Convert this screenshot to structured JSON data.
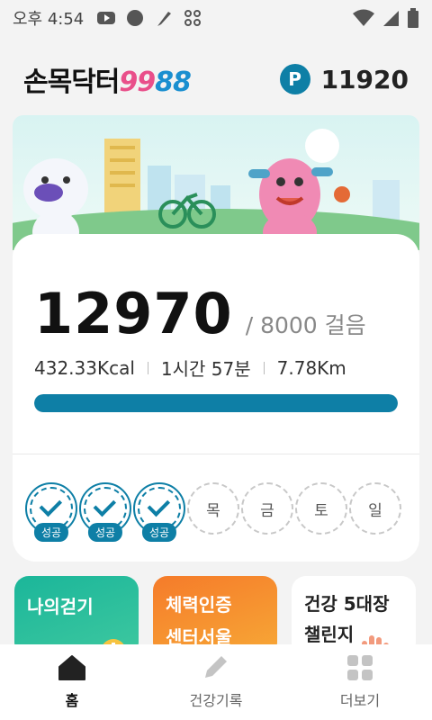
{
  "status": {
    "time": "오후 4:54"
  },
  "header": {
    "logo_text": "손목닥터",
    "logo_num1": "99",
    "logo_num2": "88",
    "point_badge": "P",
    "points": "11920"
  },
  "steps": {
    "current": "12970",
    "goal": "/ 8000 걸음",
    "progress_fraction": 1.0
  },
  "stats": {
    "kcal": "432.33Kcal",
    "time": "1시간 57분",
    "distance": "7.78Km"
  },
  "week": {
    "success_label": "성공",
    "days": [
      {
        "label": "",
        "done": true
      },
      {
        "label": "",
        "done": true
      },
      {
        "label": "",
        "done": true
      },
      {
        "label": "목",
        "done": false
      },
      {
        "label": "금",
        "done": false
      },
      {
        "label": "토",
        "done": false
      },
      {
        "label": "일",
        "done": false
      }
    ]
  },
  "tiles": {
    "t1": "나의걷기",
    "t2_line1": "체력인증",
    "t2_line2": "센터서울",
    "t3_line1": "건강 5대장",
    "t3_line2": "챌린지"
  },
  "tabs": {
    "home": "홈",
    "record": "건강기록",
    "more": "더보기"
  },
  "colors": {
    "accent": "#0e7fa6",
    "green_tile": "#1bb69a",
    "orange_tile": "#f57b2a"
  }
}
